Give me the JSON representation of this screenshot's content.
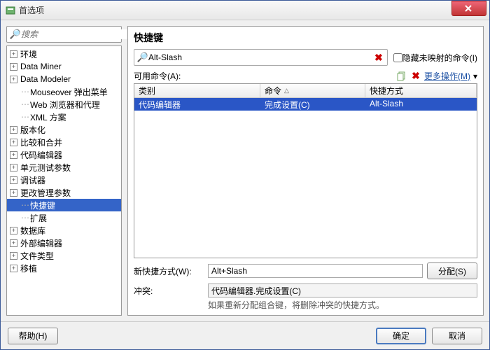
{
  "window": {
    "title": "首选项"
  },
  "search": {
    "placeholder": "搜索"
  },
  "tree": [
    {
      "label": "环境",
      "expandable": true,
      "indent": 0
    },
    {
      "label": "Data Miner",
      "expandable": true,
      "indent": 0
    },
    {
      "label": "Data Modeler",
      "expandable": true,
      "indent": 0
    },
    {
      "label": "Mouseover 弹出菜单",
      "expandable": false,
      "indent": 1
    },
    {
      "label": "Web 浏览器和代理",
      "expandable": false,
      "indent": 1
    },
    {
      "label": "XML 方案",
      "expandable": false,
      "indent": 1
    },
    {
      "label": "版本化",
      "expandable": true,
      "indent": 0
    },
    {
      "label": "比较和合并",
      "expandable": true,
      "indent": 0
    },
    {
      "label": "代码编辑器",
      "expandable": true,
      "indent": 0
    },
    {
      "label": "单元测试参数",
      "expandable": true,
      "indent": 0
    },
    {
      "label": "调试器",
      "expandable": true,
      "indent": 0
    },
    {
      "label": "更改管理参数",
      "expandable": true,
      "indent": 0
    },
    {
      "label": "快捷键",
      "expandable": false,
      "indent": 1,
      "selected": true
    },
    {
      "label": "扩展",
      "expandable": false,
      "indent": 1
    },
    {
      "label": "数据库",
      "expandable": true,
      "indent": 0
    },
    {
      "label": "外部编辑器",
      "expandable": true,
      "indent": 0
    },
    {
      "label": "文件类型",
      "expandable": true,
      "indent": 0
    },
    {
      "label": "移植",
      "expandable": true,
      "indent": 0
    }
  ],
  "panel": {
    "title": "快捷键",
    "filter_value": "Alt-Slash",
    "hide_unmapped_label": "隐藏未映射的命令(I)",
    "available_label": "可用命令(A):",
    "more_actions_label": "更多操作(M)",
    "columns": {
      "category": "类别",
      "command": "命令",
      "shortcut": "快捷方式"
    },
    "rows": [
      {
        "category": "代码编辑器",
        "command": "完成设置(C)",
        "shortcut": "Alt-Slash",
        "selected": true
      }
    ],
    "new_shortcut_label": "新快捷方式(W):",
    "new_shortcut_value": "Alt+Slash",
    "assign_label": "分配(S)",
    "conflict_label": "冲突:",
    "conflict_value": "代码编辑器.完成设置(C)",
    "hint": "如果重新分配组合键，将删除冲突的快捷方式。"
  },
  "footer": {
    "help": "帮助(H)",
    "ok": "确定",
    "cancel": "取消"
  }
}
